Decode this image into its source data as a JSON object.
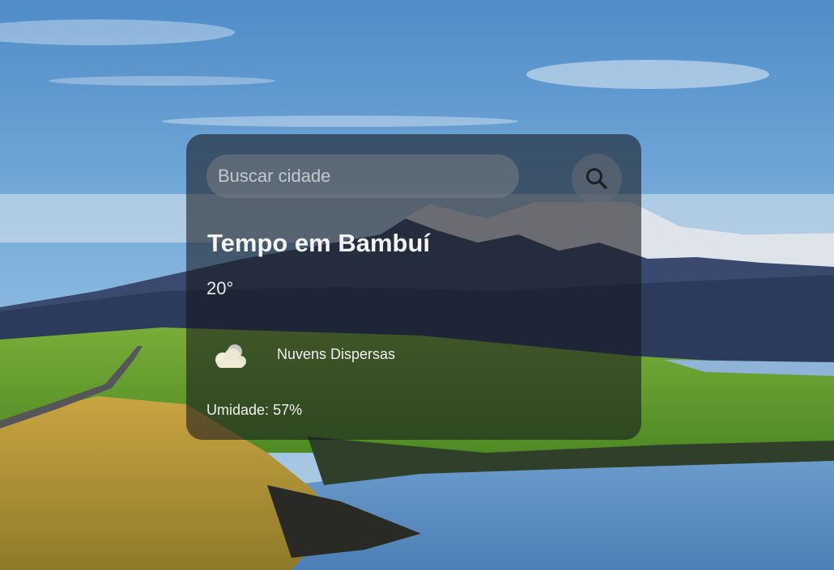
{
  "search": {
    "placeholder": "Buscar cidade",
    "value": "",
    "icon": "search-icon"
  },
  "weather": {
    "title_prefix": "Tempo em",
    "city": "Bambuí",
    "temperature": "20°",
    "icon": "cloud-icon",
    "description": "Nuvens Dispersas",
    "humidity_label": "Umidade:",
    "humidity_value": "57%"
  },
  "colors": {
    "card_background": "rgba(20,22,28,0.58)",
    "text": "#f5f5f5",
    "input_background": "rgba(120,125,132,0.55)",
    "sky": "#7fb1dc",
    "grass": "#5f9a2c",
    "water": "#5e8fc2"
  }
}
